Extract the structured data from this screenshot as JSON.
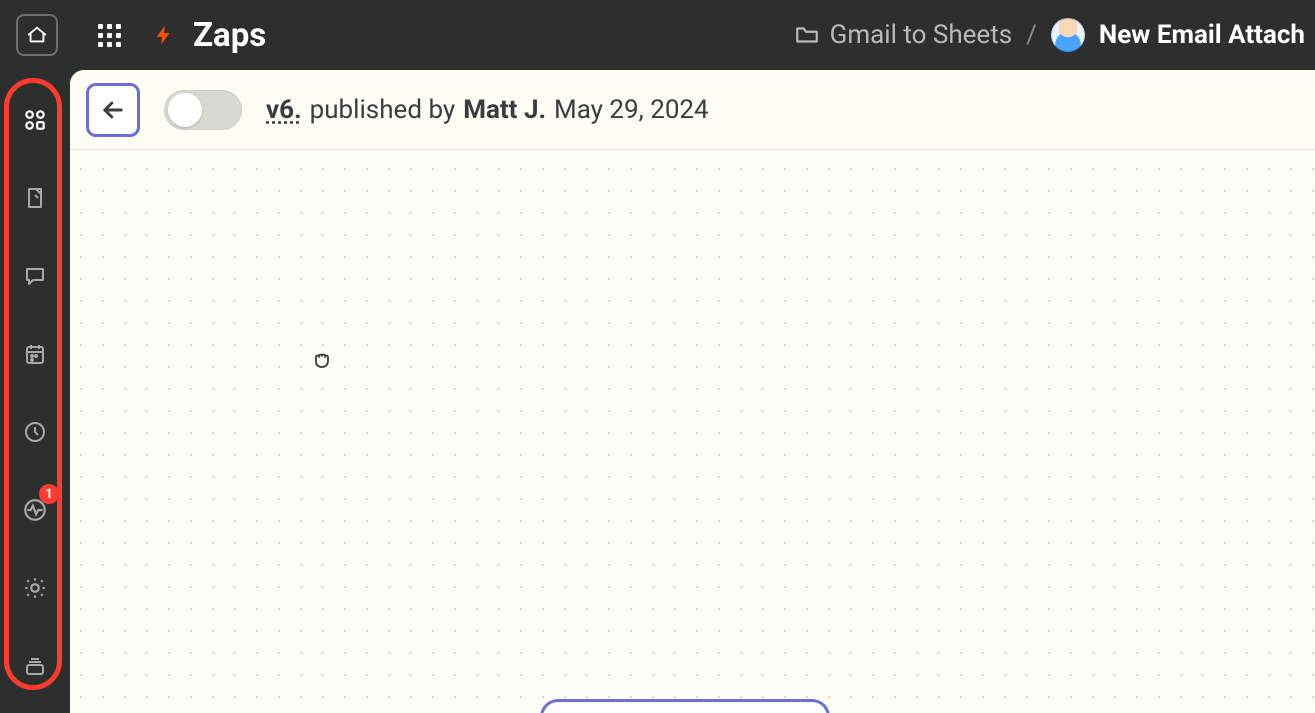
{
  "topbar": {
    "title": "Zaps",
    "breadcrumb": {
      "folder_label": "Gmail to Sheets",
      "separator": "/",
      "zap_name": "New Email Attach"
    }
  },
  "sidebar": {
    "items": [
      {
        "name": "assets",
        "icon": "assets-icon",
        "active": true,
        "badge": null
      },
      {
        "name": "notes",
        "icon": "note-icon",
        "active": false,
        "badge": null
      },
      {
        "name": "comments",
        "icon": "chat-icon",
        "active": false,
        "badge": null
      },
      {
        "name": "calendar",
        "icon": "calendar-icon",
        "active": false,
        "badge": null
      },
      {
        "name": "history",
        "icon": "clock-icon",
        "active": false,
        "badge": null
      },
      {
        "name": "status",
        "icon": "status-icon",
        "active": false,
        "badge": "1"
      },
      {
        "name": "settings",
        "icon": "gear-icon",
        "active": false,
        "badge": null
      },
      {
        "name": "versions",
        "icon": "versions-icon",
        "active": false,
        "badge": null
      }
    ]
  },
  "version_bar": {
    "toggle_on": false,
    "version_label": "v6.",
    "published_prefix": "published by",
    "author": "Matt J.",
    "date": "May 29, 2024"
  }
}
